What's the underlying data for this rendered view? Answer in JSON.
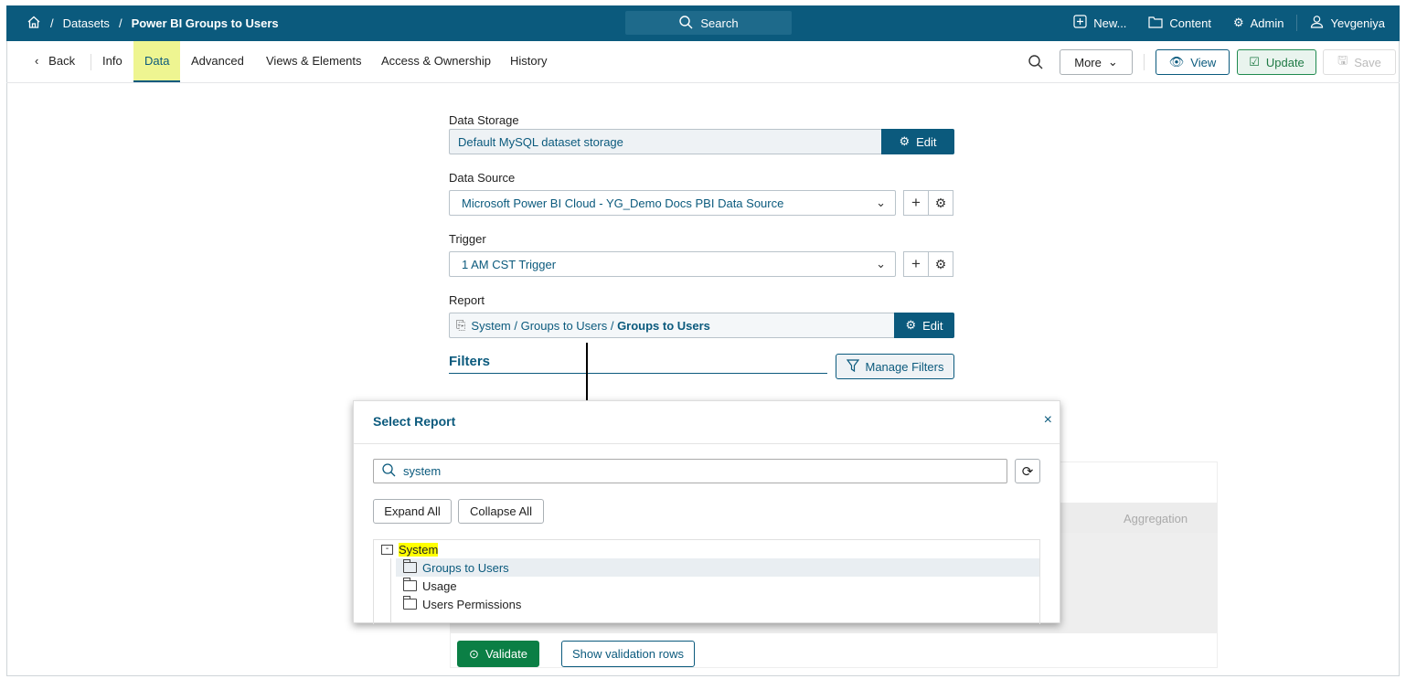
{
  "header": {
    "breadcrumb": [
      "Datasets",
      "Power BI Groups to Users"
    ],
    "search": "Search",
    "new": "New...",
    "content": "Content",
    "admin": "Admin",
    "user": "Yevgeniya"
  },
  "tabs": {
    "back": "Back",
    "items": [
      "Info",
      "Data",
      "Advanced",
      "Views & Elements",
      "Access & Ownership",
      "History"
    ],
    "active": "Data",
    "more": "More",
    "view": "View",
    "update": "Update",
    "save": "Save"
  },
  "form": {
    "data_storage_label": "Data Storage",
    "data_storage_value": "Default MySQL dataset storage",
    "edit": "Edit",
    "data_source_label": "Data Source",
    "data_source_value": "Microsoft Power BI Cloud - YG_Demo Docs PBI Data Source",
    "trigger_label": "Trigger",
    "trigger_value": "1 AM CST Trigger",
    "report_label": "Report",
    "report_path": "System / Groups to Users / ",
    "report_name": "Groups to Users",
    "filters_title": "Filters",
    "manage_filters": "Manage Filters"
  },
  "background": {
    "aggregation": "Aggregation",
    "validate": "Validate",
    "show_rows": "Show validation rows"
  },
  "modal": {
    "title": "Select Report",
    "search_value": "system",
    "expand_all": "Expand All",
    "collapse_all": "Collapse All",
    "tree": {
      "root": "System",
      "children": [
        "Groups to Users",
        "Usage",
        "Users Permissions"
      ]
    }
  },
  "colors": {
    "brand": "#0b5a7d",
    "active_tab": "#eef591",
    "highlight": "#ffff00",
    "validate": "#0b7f45"
  }
}
